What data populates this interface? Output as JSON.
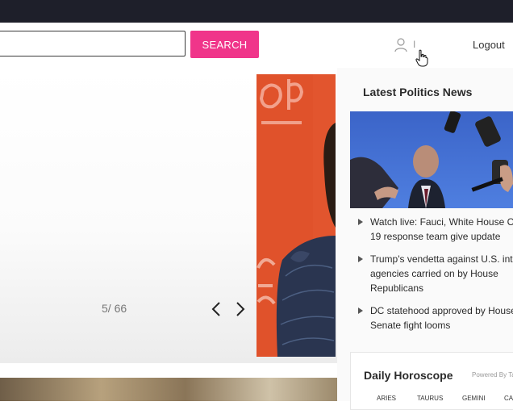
{
  "header": {
    "search_placeholder": "",
    "search_button_label": "SEARCH",
    "user_name": "I",
    "logout_label": "Logout"
  },
  "gallery": {
    "counter": "5/ 66"
  },
  "sidebar": {
    "politics_title": "Latest Politics News",
    "news": [
      {
        "lines": [
          "Watch live: Fauci, White House CC",
          "19 response team give update"
        ]
      },
      {
        "lines": [
          "Trump's vendetta against U.S. intell",
          "agencies carried on by House",
          "Republicans"
        ]
      },
      {
        "lines": [
          "DC statehood approved by House",
          "Senate fight looms"
        ]
      }
    ],
    "horoscope": {
      "title": "Daily Horoscope",
      "powered_by": "Powered By Ta",
      "signs": [
        "ARIES",
        "TAURUS",
        "GEMINI",
        "CA"
      ]
    }
  },
  "colors": {
    "accent": "#f0358a",
    "topbar": "#1e1f2a"
  },
  "icons": {
    "user": "user-outline-icon",
    "cursor": "hand-pointer-icon",
    "prev": "chevron-left-icon",
    "next": "chevron-right-icon",
    "bullet": "triangle-right-icon"
  }
}
